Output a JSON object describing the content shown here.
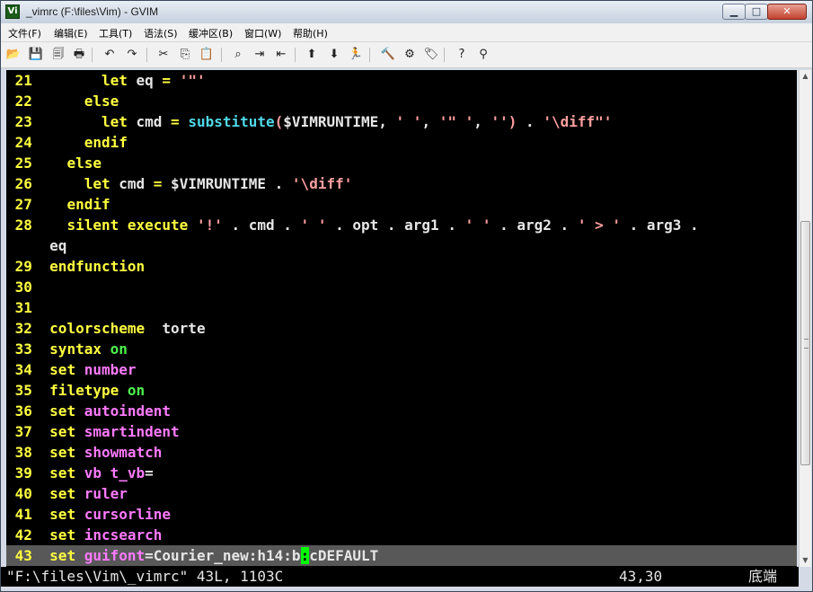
{
  "window": {
    "title": "_vimrc (F:\\files\\Vim) - GVIM",
    "icon_label": "Vi",
    "controls": {
      "minimize": "▁",
      "maximize": "□",
      "close": "✕"
    }
  },
  "menu": {
    "items": [
      {
        "label": "文件(F)"
      },
      {
        "label": "编辑(E)"
      },
      {
        "label": "工具(T)"
      },
      {
        "label": "语法(S)"
      },
      {
        "label": "缓冲区(B)"
      },
      {
        "label": "窗口(W)"
      },
      {
        "label": "帮助(H)"
      }
    ]
  },
  "toolbar": {
    "buttons": [
      {
        "name": "open-icon",
        "glyph": "📂"
      },
      {
        "name": "save-icon",
        "glyph": "💾"
      },
      {
        "name": "save-all-icon",
        "glyph": "🗐"
      },
      {
        "name": "print-icon",
        "glyph": "🖶"
      },
      {
        "name": "undo-icon",
        "glyph": "↶"
      },
      {
        "name": "redo-icon",
        "glyph": "↷"
      },
      {
        "name": "cut-icon",
        "glyph": "✂"
      },
      {
        "name": "copy-icon",
        "glyph": "⎘"
      },
      {
        "name": "paste-icon",
        "glyph": "📋"
      },
      {
        "name": "find-replace-icon",
        "glyph": "⌕"
      },
      {
        "name": "find-next-icon",
        "glyph": "⇥"
      },
      {
        "name": "find-prev-icon",
        "glyph": "⇤"
      },
      {
        "name": "load-session-icon",
        "glyph": "⬆"
      },
      {
        "name": "save-session-icon",
        "glyph": "⬇"
      },
      {
        "name": "run-script-icon",
        "glyph": "🏃"
      },
      {
        "name": "make-icon",
        "glyph": "🔨"
      },
      {
        "name": "run-ctags-icon",
        "glyph": "⚙"
      },
      {
        "name": "jump-tag-icon",
        "glyph": "🏷"
      },
      {
        "name": "help-icon",
        "glyph": "?"
      },
      {
        "name": "find-help-icon",
        "glyph": "⚲"
      }
    ]
  },
  "editor": {
    "colors": {
      "background": "#000000",
      "line_number": "#ffff40",
      "keyword": "#ffff40",
      "string": "#ff9f9f",
      "function": "#4fd8e8",
      "option": "#ff7aff",
      "value_on": "#4ef54e",
      "cursor": "#00ff00",
      "cursorline": "#585858"
    },
    "lines": [
      {
        "num": "21",
        "segs": [
          [
            "sm",
            "      "
          ],
          [
            "kw",
            "let"
          ],
          [
            "sm",
            " eq "
          ],
          [
            "op",
            "="
          ],
          [
            "sm",
            " "
          ],
          [
            "st",
            "'\"'"
          ]
        ]
      },
      {
        "num": "22",
        "segs": [
          [
            "sm",
            "    "
          ],
          [
            "kw",
            "else"
          ]
        ]
      },
      {
        "num": "23",
        "segs": [
          [
            "sm",
            "      "
          ],
          [
            "kw",
            "let"
          ],
          [
            "sm",
            " cmd "
          ],
          [
            "op",
            "="
          ],
          [
            "sm",
            " "
          ],
          [
            "fn",
            "substitute"
          ],
          [
            "st",
            "("
          ],
          [
            "sm",
            "$VIMRUNTIME, "
          ],
          [
            "st",
            "' '"
          ],
          [
            "sm",
            ", "
          ],
          [
            "st",
            "'\" '"
          ],
          [
            "sm",
            ", "
          ],
          [
            "st",
            "'')"
          ],
          [
            "sm",
            " . "
          ],
          [
            "st",
            "'\\diff\"'"
          ]
        ]
      },
      {
        "num": "24",
        "segs": [
          [
            "sm",
            "    "
          ],
          [
            "kw",
            "endif"
          ]
        ]
      },
      {
        "num": "25",
        "segs": [
          [
            "sm",
            "  "
          ],
          [
            "kw",
            "else"
          ]
        ]
      },
      {
        "num": "26",
        "segs": [
          [
            "sm",
            "    "
          ],
          [
            "kw",
            "let"
          ],
          [
            "sm",
            " cmd "
          ],
          [
            "op",
            "="
          ],
          [
            "sm",
            " $VIMRUNTIME . "
          ],
          [
            "st",
            "'\\diff'"
          ]
        ]
      },
      {
        "num": "27",
        "segs": [
          [
            "sm",
            "  "
          ],
          [
            "kw",
            "endif"
          ]
        ]
      },
      {
        "num": "28",
        "segs": [
          [
            "sm",
            "  "
          ],
          [
            "kw",
            "silent execute"
          ],
          [
            "sm",
            " "
          ],
          [
            "st",
            "'!'"
          ],
          [
            "sm",
            " . cmd . "
          ],
          [
            "st",
            "' '"
          ],
          [
            "sm",
            " . opt . arg1 . "
          ],
          [
            "st",
            "' '"
          ],
          [
            "sm",
            " . arg2 . "
          ],
          [
            "st",
            "' > '"
          ],
          [
            "sm",
            " . arg3 ."
          ]
        ]
      },
      {
        "num": "",
        "segs": [
          [
            "sm",
            "eq"
          ]
        ]
      },
      {
        "num": "29",
        "segs": [
          [
            "kw",
            "endfunction"
          ]
        ]
      },
      {
        "num": "30",
        "segs": []
      },
      {
        "num": "31",
        "segs": []
      },
      {
        "num": "32",
        "segs": [
          [
            "kw",
            "colorscheme"
          ],
          [
            "sm",
            "  torte"
          ]
        ]
      },
      {
        "num": "33",
        "segs": [
          [
            "kw",
            "syntax"
          ],
          [
            "sm",
            " "
          ],
          [
            "on",
            "on"
          ]
        ]
      },
      {
        "num": "34",
        "segs": [
          [
            "kw",
            "set"
          ],
          [
            "sm",
            " "
          ],
          [
            "pa",
            "number"
          ]
        ]
      },
      {
        "num": "35",
        "segs": [
          [
            "kw",
            "filetype"
          ],
          [
            "sm",
            " "
          ],
          [
            "on",
            "on"
          ]
        ]
      },
      {
        "num": "36",
        "segs": [
          [
            "kw",
            "set"
          ],
          [
            "sm",
            " "
          ],
          [
            "pa",
            "autoindent"
          ]
        ]
      },
      {
        "num": "37",
        "segs": [
          [
            "kw",
            "set"
          ],
          [
            "sm",
            " "
          ],
          [
            "pa",
            "smartindent"
          ]
        ]
      },
      {
        "num": "38",
        "segs": [
          [
            "kw",
            "set"
          ],
          [
            "sm",
            " "
          ],
          [
            "pa",
            "showmatch"
          ]
        ]
      },
      {
        "num": "39",
        "segs": [
          [
            "kw",
            "set"
          ],
          [
            "sm",
            " "
          ],
          [
            "pa",
            "vb t_vb"
          ],
          [
            "sm",
            "="
          ]
        ]
      },
      {
        "num": "40",
        "segs": [
          [
            "kw",
            "set"
          ],
          [
            "sm",
            " "
          ],
          [
            "pa",
            "ruler"
          ]
        ]
      },
      {
        "num": "41",
        "segs": [
          [
            "kw",
            "set"
          ],
          [
            "sm",
            " "
          ],
          [
            "pa",
            "cursorline"
          ]
        ]
      },
      {
        "num": "42",
        "segs": [
          [
            "kw",
            "set"
          ],
          [
            "sm",
            " "
          ],
          [
            "pa",
            "incsearch"
          ]
        ]
      },
      {
        "num": "43",
        "cursorline": true,
        "segs": [
          [
            "kw",
            "set"
          ],
          [
            "sm",
            " "
          ],
          [
            "pa",
            "guifont"
          ],
          [
            "sm",
            "=Courier_new:h14:b"
          ],
          [
            "cur",
            ":"
          ],
          [
            "sm",
            "cDEFAULT"
          ]
        ]
      }
    ]
  },
  "statusline": {
    "file_info": "\"F:\\files\\Vim\\_vimrc\" 43L, 1103C",
    "cursor_pos": "43,30",
    "scroll_pos": "底端"
  },
  "scrollbar": {
    "up": "▲",
    "down": "▼"
  }
}
